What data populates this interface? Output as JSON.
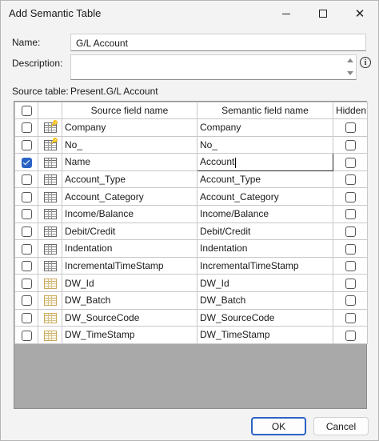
{
  "window": {
    "title": "Add Semantic Table"
  },
  "form": {
    "name_label": "Name:",
    "name_value": "G/L Account",
    "description_label": "Description:",
    "description_value": "",
    "source_table_label": "Source table:",
    "source_table_value": "Present.G/L Account"
  },
  "grid": {
    "headers": {
      "source": "Source field name",
      "semantic": "Semantic field name",
      "hidden": "Hidden"
    },
    "rows": [
      {
        "source": "Company",
        "semantic": "Company",
        "checked": false,
        "icon": "key-table-icon"
      },
      {
        "source": "No_",
        "semantic": "No_",
        "checked": false,
        "icon": "key-table-icon"
      },
      {
        "source": "Name",
        "semantic": "Account",
        "checked": true,
        "icon": "table-icon"
      },
      {
        "source": "Account_Type",
        "semantic": "Account_Type",
        "checked": false,
        "icon": "table-icon"
      },
      {
        "source": "Account_Category",
        "semantic": "Account_Category",
        "checked": false,
        "icon": "table-icon"
      },
      {
        "source": "Income/Balance",
        "semantic": "Income/Balance",
        "checked": false,
        "icon": "table-icon"
      },
      {
        "source": "Debit/Credit",
        "semantic": "Debit/Credit",
        "checked": false,
        "icon": "table-icon"
      },
      {
        "source": "Indentation",
        "semantic": "Indentation",
        "checked": false,
        "icon": "table-icon"
      },
      {
        "source": "IncrementalTimeStamp",
        "semantic": "IncrementalTimeStamp",
        "checked": false,
        "icon": "table-icon"
      },
      {
        "source": "DW_Id",
        "semantic": "DW_Id",
        "checked": false,
        "icon": "dw-table-icon"
      },
      {
        "source": "DW_Batch",
        "semantic": "DW_Batch",
        "checked": false,
        "icon": "dw-table-icon"
      },
      {
        "source": "DW_SourceCode",
        "semantic": "DW_SourceCode",
        "checked": false,
        "icon": "dw-table-icon"
      },
      {
        "source": "DW_TimeStamp",
        "semantic": "DW_TimeStamp",
        "checked": false,
        "icon": "dw-table-icon"
      }
    ]
  },
  "buttons": {
    "ok": "OK",
    "cancel": "Cancel"
  },
  "colors": {
    "accent": "#2b63c5"
  }
}
